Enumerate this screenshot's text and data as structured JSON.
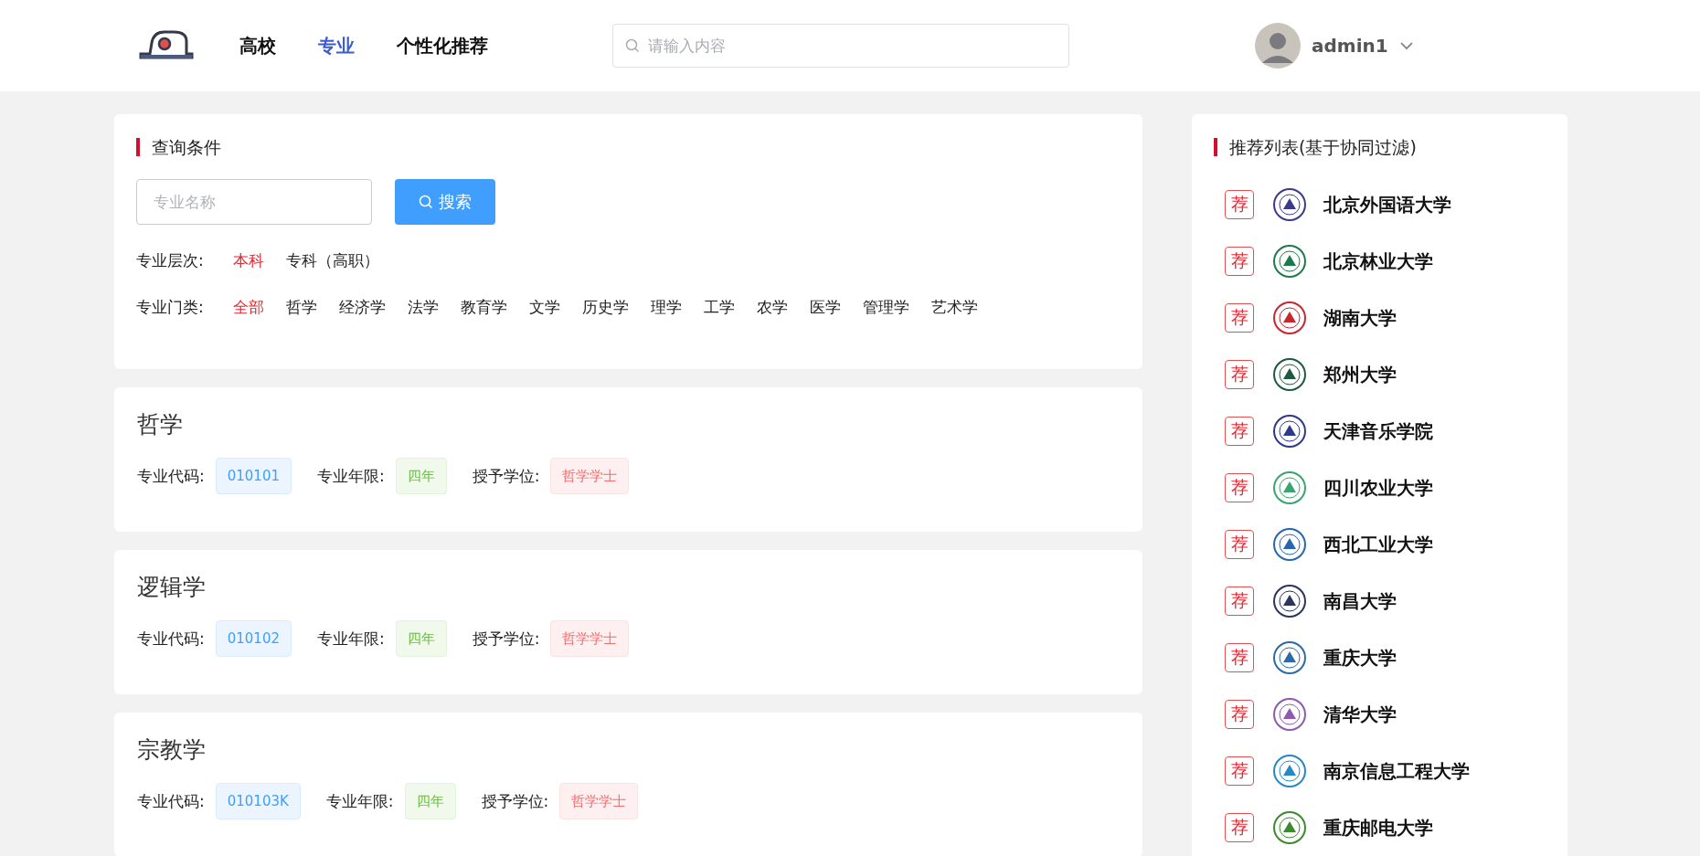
{
  "nav": {
    "items": [
      {
        "label": "高校",
        "selected": false
      },
      {
        "label": "专业",
        "selected": true
      },
      {
        "label": "个性化推荐",
        "selected": false
      }
    ],
    "search": {
      "placeholder": "请输入内容"
    },
    "user": {
      "name": "admin1"
    }
  },
  "filter": {
    "title": "查询条件",
    "name_field": {
      "placeholder": "专业名称"
    },
    "search_button": "搜索",
    "level": {
      "label": "专业层次:",
      "options": [
        {
          "label": "本科",
          "selected": true
        },
        {
          "label": "专科（高职）",
          "selected": false
        }
      ]
    },
    "category": {
      "label": "专业门类:",
      "options": [
        {
          "label": "全部",
          "selected": true
        },
        {
          "label": "哲学",
          "selected": false
        },
        {
          "label": "经济学",
          "selected": false
        },
        {
          "label": "法学",
          "selected": false
        },
        {
          "label": "教育学",
          "selected": false
        },
        {
          "label": "文学",
          "selected": false
        },
        {
          "label": "历史学",
          "selected": false
        },
        {
          "label": "理学",
          "selected": false
        },
        {
          "label": "工学",
          "selected": false
        },
        {
          "label": "农学",
          "selected": false
        },
        {
          "label": "医学",
          "selected": false
        },
        {
          "label": "管理学",
          "selected": false
        },
        {
          "label": "艺术学",
          "selected": false
        }
      ]
    }
  },
  "majors": [
    {
      "name": "哲学",
      "code_label": "专业代码:",
      "code": "010101",
      "years_label": "专业年限:",
      "years": "四年",
      "degree_label": "授予学位:",
      "degree": "哲学学士"
    },
    {
      "name": "逻辑学",
      "code_label": "专业代码:",
      "code": "010102",
      "years_label": "专业年限:",
      "years": "四年",
      "degree_label": "授予学位:",
      "degree": "哲学学士"
    },
    {
      "name": "宗教学",
      "code_label": "专业代码:",
      "code": "010103K",
      "years_label": "专业年限:",
      "years": "四年",
      "degree_label": "授予学位:",
      "degree": "哲学学士"
    }
  ],
  "recommend": {
    "title": "推荐列表(基于协同过滤)",
    "items": [
      {
        "badge": "荐",
        "name": "北京外国语大学",
        "color": "#3b3a8f"
      },
      {
        "badge": "荐",
        "name": "北京林业大学",
        "color": "#1f7a4a"
      },
      {
        "badge": "荐",
        "name": "湖南大学",
        "color": "#c8282d"
      },
      {
        "badge": "荐",
        "name": "郑州大学",
        "color": "#1e5a3c"
      },
      {
        "badge": "荐",
        "name": "天津音乐学院",
        "color": "#2d3a8c"
      },
      {
        "badge": "荐",
        "name": "四川农业大学",
        "color": "#3aa56e"
      },
      {
        "badge": "荐",
        "name": "西北工业大学",
        "color": "#2667b0"
      },
      {
        "badge": "荐",
        "name": "南昌大学",
        "color": "#2b3560"
      },
      {
        "badge": "荐",
        "name": "重庆大学",
        "color": "#2f6aa8"
      },
      {
        "badge": "荐",
        "name": "清华大学",
        "color": "#8d5ab0"
      },
      {
        "badge": "荐",
        "name": "南京信息工程大学",
        "color": "#2789c4"
      },
      {
        "badge": "荐",
        "name": "重庆邮电大学",
        "color": "#3d8a2e"
      }
    ]
  }
}
